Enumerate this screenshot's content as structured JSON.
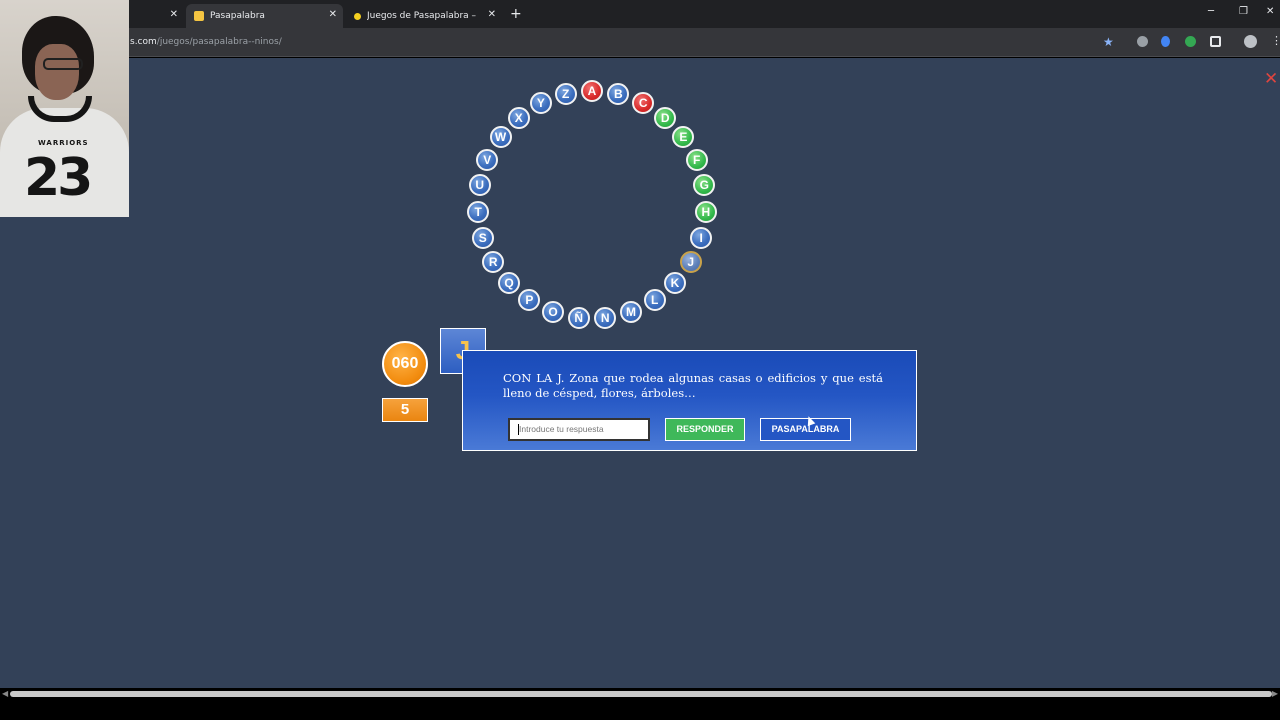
{
  "browser": {
    "tabs": [
      {
        "title": "",
        "active": false
      },
      {
        "title": "Pasapalabra",
        "active": true
      },
      {
        "title": "Juegos de Pasapalabra – COKITOS",
        "active": false
      }
    ],
    "url_host": "s.com",
    "url_path": "/juegos/pasapalabra--ninos/"
  },
  "game": {
    "rosco": [
      {
        "letter": "A",
        "status": "red"
      },
      {
        "letter": "B",
        "status": "blue"
      },
      {
        "letter": "C",
        "status": "red"
      },
      {
        "letter": "D",
        "status": "green"
      },
      {
        "letter": "E",
        "status": "green"
      },
      {
        "letter": "F",
        "status": "green"
      },
      {
        "letter": "G",
        "status": "green"
      },
      {
        "letter": "H",
        "status": "green"
      },
      {
        "letter": "I",
        "status": "blue"
      },
      {
        "letter": "J",
        "status": "current"
      },
      {
        "letter": "K",
        "status": "blue"
      },
      {
        "letter": "L",
        "status": "blue"
      },
      {
        "letter": "M",
        "status": "blue"
      },
      {
        "letter": "N",
        "status": "blue"
      },
      {
        "letter": "Ñ",
        "status": "blue"
      },
      {
        "letter": "O",
        "status": "blue"
      },
      {
        "letter": "P",
        "status": "blue"
      },
      {
        "letter": "Q",
        "status": "blue"
      },
      {
        "letter": "R",
        "status": "blue"
      },
      {
        "letter": "S",
        "status": "blue"
      },
      {
        "letter": "T",
        "status": "blue"
      },
      {
        "letter": "U",
        "status": "blue"
      },
      {
        "letter": "V",
        "status": "blue"
      },
      {
        "letter": "W",
        "status": "blue"
      },
      {
        "letter": "X",
        "status": "blue"
      },
      {
        "letter": "Y",
        "status": "blue"
      },
      {
        "letter": "Z",
        "status": "blue"
      }
    ],
    "timer": "060",
    "correct_count": "5",
    "current_letter": "J",
    "question": "CON LA J. Zona que rodea algunas casas o edificios y que está lleno de césped, flores, árboles…",
    "answer_placeholder": "Introduce tu respuesta",
    "respond_label": "RESPONDER",
    "pass_label": "PASAPALABRA",
    "close_symbol": "✕"
  },
  "webcam": {
    "jersey_text": "WARRIORS",
    "jersey_number": "23"
  },
  "colors": {
    "page_bg": "#334158",
    "panel_blue": "#2456c4",
    "correct_green": "#33b94b",
    "wrong_red": "#d92a2a",
    "score_orange": "#f28c0f"
  }
}
